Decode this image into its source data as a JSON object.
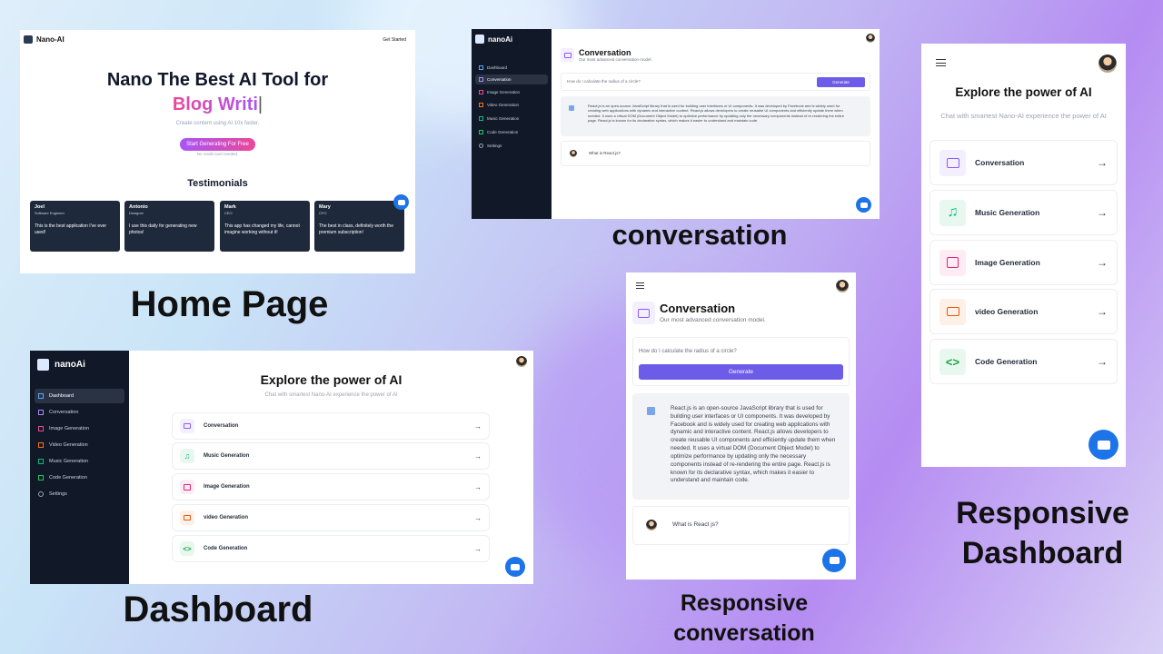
{
  "home": {
    "logo": "Nano-AI",
    "get_started": "Get Started",
    "hero_line1": "Nano The Best AI Tool for",
    "hero_typed": "Blog Writi",
    "subtitle": "Create content using AI 10x faster.",
    "cta": "Start Generating For Free",
    "note": "No credit card needed.",
    "testimonials_title": "Testimonials",
    "testimonials": [
      {
        "name": "Joel",
        "role": "Software Engineer",
        "text": "This is the best application I've ever used!"
      },
      {
        "name": "Antonio",
        "role": "Designer",
        "text": "I use this daily for generating new photos!"
      },
      {
        "name": "Mark",
        "role": "CEO",
        "text": "This app has changed my life, cannot imagine working without it!"
      },
      {
        "name": "Mary",
        "role": "CFO",
        "text": "The best in class, definitely worth the premium subscription!"
      }
    ]
  },
  "captions": {
    "home": "Home Page",
    "conversation": "conversation",
    "dashboard": "Dashboard",
    "resp_conversation": "Responsive conversation",
    "resp_dashboard": "Responsive Dashboard"
  },
  "sidebar": {
    "brand": "nanoAi",
    "items": [
      "Dashboard",
      "Conversation",
      "Image Generation",
      "Video Generation",
      "Music Generation",
      "Code Generation",
      "Settings"
    ]
  },
  "conversation": {
    "title": "Conversation",
    "subtitle": "Our most advanced conversation model.",
    "prompt": "How do I calculate the radius of a circle?",
    "generate": "Generate",
    "answer": "React.js is an open-source JavaScript library that is used for building user interfaces or UI components. It was developed by Facebook and is widely used for creating web applications with dynamic and interactive content. React.js allows developers to create reusable UI components and efficiently update them when needed. It uses a virtual DOM (Document Object Model) to optimize performance by updating only the necessary components instead of re-rendering the entire page. React.js is known for its declarative syntax, which makes it easier to understand and maintain code.",
    "user_msg": "What is React.js?",
    "user_msg_short": "What is React js?"
  },
  "dashboard": {
    "title": "Explore the power of AI",
    "subtitle": "Chat with smartest Nano-AI experience the power of AI",
    "tools": [
      {
        "label": "Conversation",
        "icon": "message-square-icon",
        "color": "#8b5cf6",
        "bg": "#f3effe"
      },
      {
        "label": "Music Generation",
        "icon": "music-icon",
        "color": "#10b981",
        "bg": "#e8f8f1"
      },
      {
        "label": "Image Generation",
        "icon": "image-icon",
        "color": "#db2777",
        "bg": "#fdecf3"
      },
      {
        "label": "video Generation",
        "icon": "video-icon",
        "color": "#ea580c",
        "bg": "#fdf0e6"
      },
      {
        "label": "Code Generation",
        "icon": "code-icon",
        "color": "#16a34a",
        "bg": "#e9f8ee"
      }
    ]
  },
  "colors": {
    "accent": "#6d5ce8",
    "pink": "#d946ef",
    "dark": "#111827"
  }
}
